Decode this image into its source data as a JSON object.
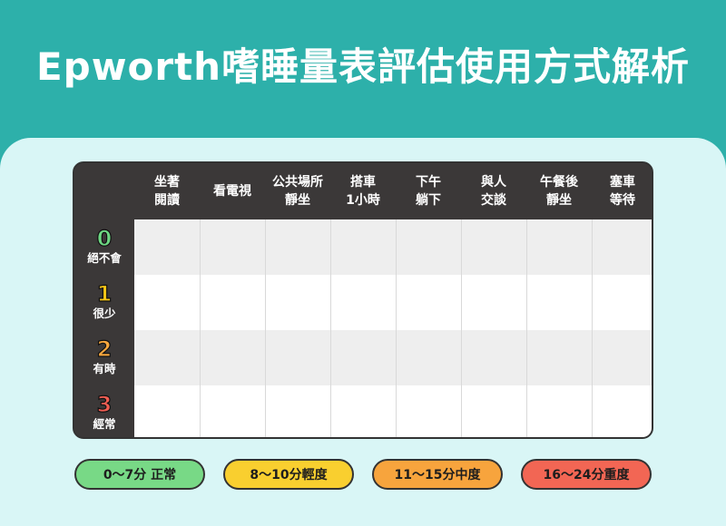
{
  "title": "Epworth嗜睡量表評估使用方式解析",
  "colors": {
    "header": "#2db0aa",
    "panel": "#d9f6f6",
    "dark": "#3b3838",
    "row_gray": "#eeeeee",
    "row_white": "#ffffff",
    "score0": "#6dd782",
    "score1": "#f7c516",
    "score2": "#f7a73e",
    "score3": "#f05d52"
  },
  "columns": [
    {
      "label": "坐著\n閱讀"
    },
    {
      "label": "看電視"
    },
    {
      "label": "公共場所\n靜坐"
    },
    {
      "label": "搭車\n1小時"
    },
    {
      "label": "下午\n躺下"
    },
    {
      "label": "與人\n交談"
    },
    {
      "label": "午餐後\n靜坐"
    },
    {
      "label": "塞車\n等待"
    }
  ],
  "rows": [
    {
      "score": "0",
      "label": "絕不會"
    },
    {
      "score": "1",
      "label": "很少"
    },
    {
      "score": "2",
      "label": "有時"
    },
    {
      "score": "3",
      "label": "經常"
    }
  ],
  "legend": [
    {
      "label": "0～7分 正常",
      "color": "#78d986"
    },
    {
      "label": "8～10分輕度",
      "color": "#f9cf2f"
    },
    {
      "label": "11～15分中度",
      "color": "#f7a43d"
    },
    {
      "label": "16～24分重度",
      "color": "#f26654"
    }
  ]
}
